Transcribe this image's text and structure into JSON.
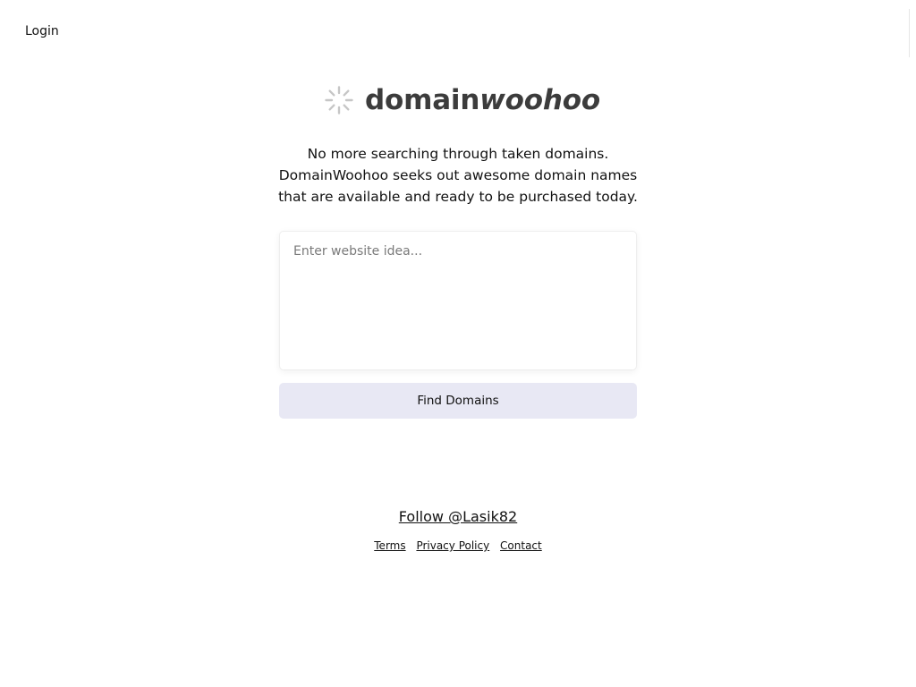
{
  "header": {
    "login_label": "Login"
  },
  "logo": {
    "icon": "loading-spinner-icon",
    "text_part1": "domain",
    "text_part2": "woohoo",
    "text_color": "#3c3c3c",
    "icon_color": "#c6c6c6"
  },
  "tagline": {
    "line1": "No more searching through taken domains.",
    "line2": "DomainWoohoo seeks out awesome domain names",
    "line3": "that are available and ready to be purchased today."
  },
  "search": {
    "placeholder": "Enter website idea...",
    "value": ""
  },
  "find_button": {
    "label": "Find Domains",
    "background": "#e8e8f4"
  },
  "footer": {
    "follow_label": "Follow @Lasik82",
    "links": [
      {
        "label": "Terms"
      },
      {
        "label": "Privacy Policy"
      },
      {
        "label": "Contact"
      }
    ]
  }
}
